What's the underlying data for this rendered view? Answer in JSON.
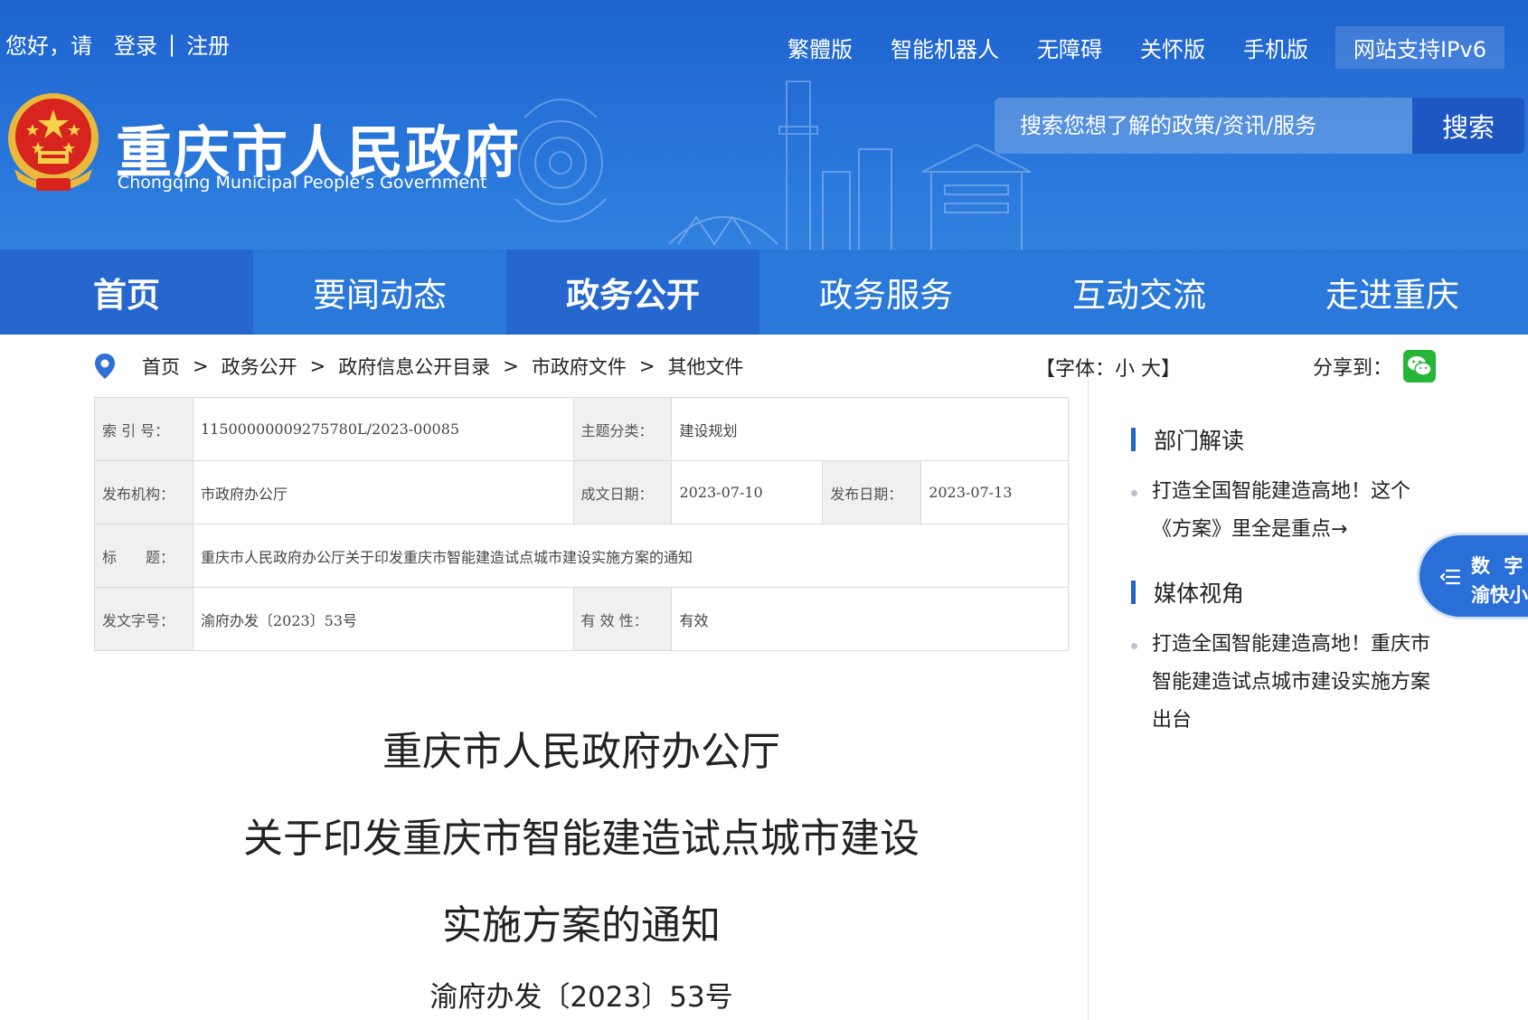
{
  "topbar": {
    "greeting": "您好，请",
    "login": "登录",
    "separator": "|",
    "register": "注册",
    "links": [
      "繁體版",
      "智能机器人",
      "无障碍",
      "关怀版",
      "手机版"
    ],
    "ipv6": "网站支持IPv6"
  },
  "brand": {
    "name_cn": "重庆市人民政府",
    "name_en": "Chongqing Municipal People’s Government"
  },
  "search": {
    "placeholder": "搜索您想了解的政策/资讯/服务",
    "button": "搜索"
  },
  "nav": [
    "首页",
    "要闻动态",
    "政务公开",
    "政务服务",
    "互动交流",
    "走进重庆"
  ],
  "breadcrumb": {
    "items": [
      "首页",
      "政务公开",
      "政府信息公开目录",
      "市政府文件",
      "其他文件"
    ],
    "separator": ">"
  },
  "font_size": {
    "open": "【字体：",
    "small": "小",
    "large": "大",
    "close": "】"
  },
  "share": {
    "label": "分享到："
  },
  "info": {
    "index_label": "索 引 号：",
    "index_value": "11500000009275780L/2023-00085",
    "topic_label": "主题分类：",
    "topic_value": "建设规划",
    "issuer_label": "发布机构：",
    "issuer_value": "市政府办公厅",
    "written_label": "成文日期：",
    "written_value": "2023-07-10",
    "published_label": "发布日期：",
    "published_value": "2023-07-13",
    "title_label": "标　　题：",
    "title_value": "重庆市人民政府办公厅关于印发重庆市智能建造试点城市建设实施方案的通知",
    "doc_no_label": "发文字号：",
    "doc_no_value": "渝府办发〔2023〕53号",
    "validity_label": "有 效 性：",
    "validity_value": "有效"
  },
  "article": {
    "line1": "重庆市人民政府办公厅",
    "line2": "关于印发重庆市智能建造试点城市建设",
    "line3": "实施方案的通知",
    "doc_no": "渝府办发〔2023〕53号"
  },
  "sidebar": {
    "section1": {
      "title": "部门解读",
      "item": "打造全国智能建造高地！这个《方案》里全是重点→"
    },
    "section2": {
      "title": "媒体视角",
      "item": "打造全国智能建造高地！重庆市智能建造试点城市建设实施方案出台"
    }
  },
  "float_badge": {
    "line1": "数 字",
    "line2": "渝快小"
  },
  "colors": {
    "header_blue": "#2a79dc",
    "nav_blue": "#2b78db",
    "nav_active": "#2567cf",
    "accent": "#2463c9"
  }
}
